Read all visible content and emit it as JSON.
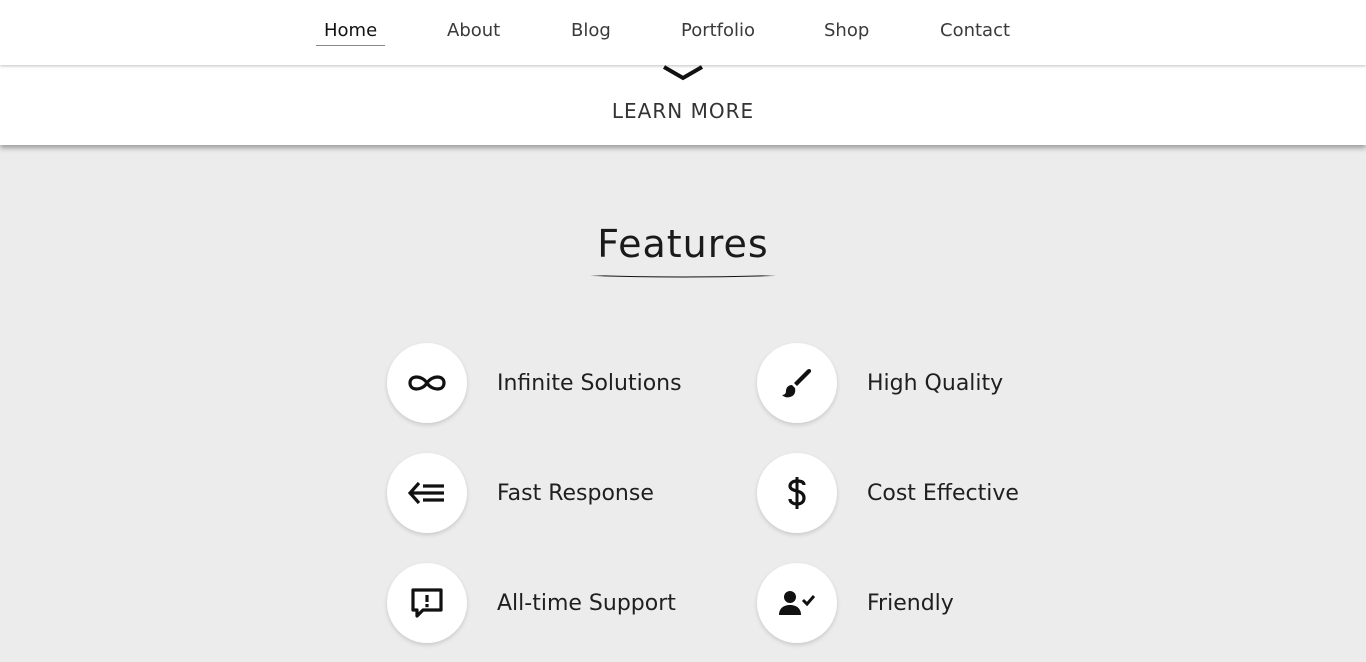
{
  "nav": {
    "items": [
      {
        "label": "Home",
        "active": true
      },
      {
        "label": "About"
      },
      {
        "label": "Blog"
      },
      {
        "label": "Portfolio"
      },
      {
        "label": "Shop"
      },
      {
        "label": "Contact"
      }
    ]
  },
  "hero": {
    "learn_more": "LEARN MORE",
    "chevron_icon": "chevron-down-icon"
  },
  "features": {
    "title": "Features",
    "items": [
      {
        "label": "Infinite Solutions",
        "icon": "infinity-icon"
      },
      {
        "label": "High Quality",
        "icon": "brush-icon"
      },
      {
        "label": "Fast Response",
        "icon": "fast-arrow-icon"
      },
      {
        "label": "Cost Effective",
        "icon": "dollar-icon"
      },
      {
        "label": "All-time Support",
        "icon": "feedback-icon"
      },
      {
        "label": "Friendly",
        "icon": "user-check-icon"
      }
    ]
  },
  "colors": {
    "background": "#ececec",
    "surface": "#ffffff",
    "text": "#1a1a1a"
  }
}
